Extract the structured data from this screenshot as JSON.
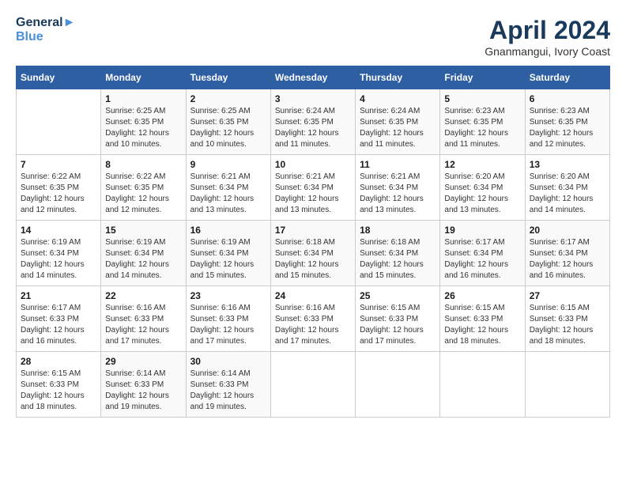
{
  "logo": {
    "line1": "General",
    "line2": "Blue"
  },
  "title": "April 2024",
  "subtitle": "Gnanmangui, Ivory Coast",
  "header": {
    "days": [
      "Sunday",
      "Monday",
      "Tuesday",
      "Wednesday",
      "Thursday",
      "Friday",
      "Saturday"
    ]
  },
  "weeks": [
    [
      {
        "day": "",
        "info": ""
      },
      {
        "day": "1",
        "info": "Sunrise: 6:25 AM\nSunset: 6:35 PM\nDaylight: 12 hours\nand 10 minutes."
      },
      {
        "day": "2",
        "info": "Sunrise: 6:25 AM\nSunset: 6:35 PM\nDaylight: 12 hours\nand 10 minutes."
      },
      {
        "day": "3",
        "info": "Sunrise: 6:24 AM\nSunset: 6:35 PM\nDaylight: 12 hours\nand 11 minutes."
      },
      {
        "day": "4",
        "info": "Sunrise: 6:24 AM\nSunset: 6:35 PM\nDaylight: 12 hours\nand 11 minutes."
      },
      {
        "day": "5",
        "info": "Sunrise: 6:23 AM\nSunset: 6:35 PM\nDaylight: 12 hours\nand 11 minutes."
      },
      {
        "day": "6",
        "info": "Sunrise: 6:23 AM\nSunset: 6:35 PM\nDaylight: 12 hours\nand 12 minutes."
      }
    ],
    [
      {
        "day": "7",
        "info": "Sunrise: 6:22 AM\nSunset: 6:35 PM\nDaylight: 12 hours\nand 12 minutes."
      },
      {
        "day": "8",
        "info": "Sunrise: 6:22 AM\nSunset: 6:35 PM\nDaylight: 12 hours\nand 12 minutes."
      },
      {
        "day": "9",
        "info": "Sunrise: 6:21 AM\nSunset: 6:34 PM\nDaylight: 12 hours\nand 13 minutes."
      },
      {
        "day": "10",
        "info": "Sunrise: 6:21 AM\nSunset: 6:34 PM\nDaylight: 12 hours\nand 13 minutes."
      },
      {
        "day": "11",
        "info": "Sunrise: 6:21 AM\nSunset: 6:34 PM\nDaylight: 12 hours\nand 13 minutes."
      },
      {
        "day": "12",
        "info": "Sunrise: 6:20 AM\nSunset: 6:34 PM\nDaylight: 12 hours\nand 13 minutes."
      },
      {
        "day": "13",
        "info": "Sunrise: 6:20 AM\nSunset: 6:34 PM\nDaylight: 12 hours\nand 14 minutes."
      }
    ],
    [
      {
        "day": "14",
        "info": "Sunrise: 6:19 AM\nSunset: 6:34 PM\nDaylight: 12 hours\nand 14 minutes."
      },
      {
        "day": "15",
        "info": "Sunrise: 6:19 AM\nSunset: 6:34 PM\nDaylight: 12 hours\nand 14 minutes."
      },
      {
        "day": "16",
        "info": "Sunrise: 6:19 AM\nSunset: 6:34 PM\nDaylight: 12 hours\nand 15 minutes."
      },
      {
        "day": "17",
        "info": "Sunrise: 6:18 AM\nSunset: 6:34 PM\nDaylight: 12 hours\nand 15 minutes."
      },
      {
        "day": "18",
        "info": "Sunrise: 6:18 AM\nSunset: 6:34 PM\nDaylight: 12 hours\nand 15 minutes."
      },
      {
        "day": "19",
        "info": "Sunrise: 6:17 AM\nSunset: 6:34 PM\nDaylight: 12 hours\nand 16 minutes."
      },
      {
        "day": "20",
        "info": "Sunrise: 6:17 AM\nSunset: 6:34 PM\nDaylight: 12 hours\nand 16 minutes."
      }
    ],
    [
      {
        "day": "21",
        "info": "Sunrise: 6:17 AM\nSunset: 6:33 PM\nDaylight: 12 hours\nand 16 minutes."
      },
      {
        "day": "22",
        "info": "Sunrise: 6:16 AM\nSunset: 6:33 PM\nDaylight: 12 hours\nand 17 minutes."
      },
      {
        "day": "23",
        "info": "Sunrise: 6:16 AM\nSunset: 6:33 PM\nDaylight: 12 hours\nand 17 minutes."
      },
      {
        "day": "24",
        "info": "Sunrise: 6:16 AM\nSunset: 6:33 PM\nDaylight: 12 hours\nand 17 minutes."
      },
      {
        "day": "25",
        "info": "Sunrise: 6:15 AM\nSunset: 6:33 PM\nDaylight: 12 hours\nand 17 minutes."
      },
      {
        "day": "26",
        "info": "Sunrise: 6:15 AM\nSunset: 6:33 PM\nDaylight: 12 hours\nand 18 minutes."
      },
      {
        "day": "27",
        "info": "Sunrise: 6:15 AM\nSunset: 6:33 PM\nDaylight: 12 hours\nand 18 minutes."
      }
    ],
    [
      {
        "day": "28",
        "info": "Sunrise: 6:15 AM\nSunset: 6:33 PM\nDaylight: 12 hours\nand 18 minutes."
      },
      {
        "day": "29",
        "info": "Sunrise: 6:14 AM\nSunset: 6:33 PM\nDaylight: 12 hours\nand 19 minutes."
      },
      {
        "day": "30",
        "info": "Sunrise: 6:14 AM\nSunset: 6:33 PM\nDaylight: 12 hours\nand 19 minutes."
      },
      {
        "day": "",
        "info": ""
      },
      {
        "day": "",
        "info": ""
      },
      {
        "day": "",
        "info": ""
      },
      {
        "day": "",
        "info": ""
      }
    ]
  ]
}
